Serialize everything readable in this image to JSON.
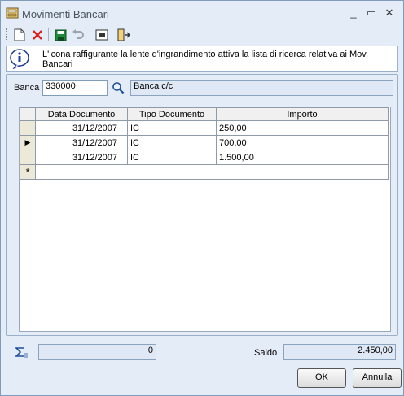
{
  "window": {
    "title": "Movimenti Bancari",
    "minimize": "_",
    "maximize": "▭",
    "close": "✕"
  },
  "info": {
    "message": "L'icona raffigurante la lente d'ingrandimento attiva la lista di ricerca relativa ai Mov. Bancari"
  },
  "filter": {
    "label": "Banca",
    "code": "330000",
    "description": "Banca c/c"
  },
  "grid": {
    "columns": [
      "Data Documento",
      "Tipo Documento",
      "Importo"
    ],
    "rows": [
      {
        "date": "31/12/2007",
        "type": "IC",
        "amount": "250,00"
      },
      {
        "date": "31/12/2007",
        "type": "IC",
        "amount": "700,00"
      },
      {
        "date": "31/12/2007",
        "type": "IC",
        "amount": "1.500,00"
      }
    ],
    "new_row_marker": "*",
    "current_marker": "▶"
  },
  "summary": {
    "count": "0",
    "saldo_label": "Saldo",
    "saldo_value": "2.450,00"
  },
  "buttons": {
    "ok": "OK",
    "cancel": "Annulla"
  }
}
